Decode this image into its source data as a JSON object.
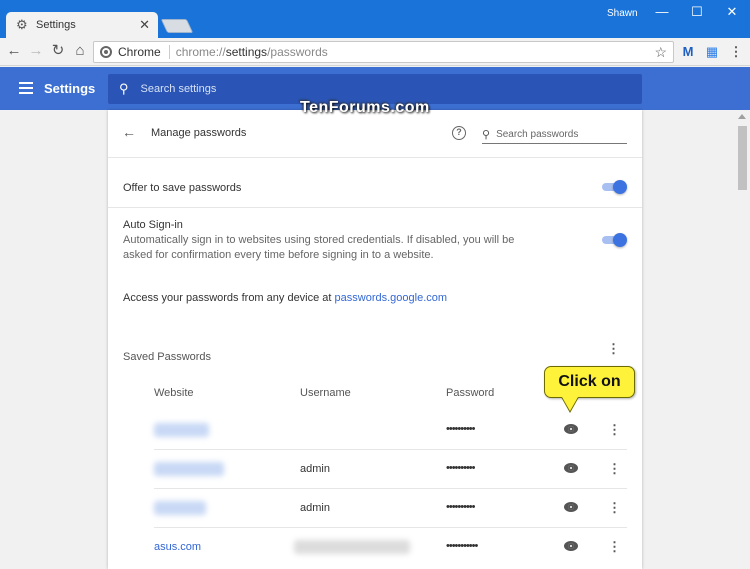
{
  "window": {
    "tab_title": "Settings",
    "tab_icon": "gear-icon",
    "user_name": "Shawn",
    "minimize": "—",
    "maximize": "☐",
    "close": "✕"
  },
  "toolbar": {
    "omnibox_label": "Chrome",
    "url_prefix": "chrome://",
    "url_host": "settings",
    "url_path": "/passwords"
  },
  "header": {
    "title": "Settings",
    "search_placeholder": "Search settings"
  },
  "watermark": "TenForums.com",
  "manage_passwords": {
    "title": "Manage passwords",
    "search_placeholder": "Search passwords",
    "offer_to_save": {
      "label": "Offer to save passwords",
      "enabled": true
    },
    "auto_signin": {
      "label": "Auto Sign-in",
      "description": "Automatically sign in to websites using stored credentials. If disabled, you will be asked for confirmation every time before signing in to a website.",
      "enabled": true
    },
    "access_text": "Access your passwords from any device at ",
    "access_link": "passwords.google.com",
    "saved_title": "Saved Passwords",
    "columns": {
      "website": "Website",
      "username": "Username",
      "password": "Password"
    },
    "rows": [
      {
        "website": "",
        "username": "",
        "password": "••••••••••"
      },
      {
        "website": "",
        "username": "admin",
        "password": "••••••••••"
      },
      {
        "website": "",
        "username": "admin",
        "password": "••••••••••"
      },
      {
        "website": "asus.com",
        "username": "",
        "password": "•••••••••••"
      }
    ]
  },
  "callout": "Click on",
  "colors": {
    "header_blue": "#3d6fd3",
    "titlebar_blue": "#1a73d9",
    "link_blue": "#3367d6",
    "toggle_blue": "#3d73e0"
  }
}
